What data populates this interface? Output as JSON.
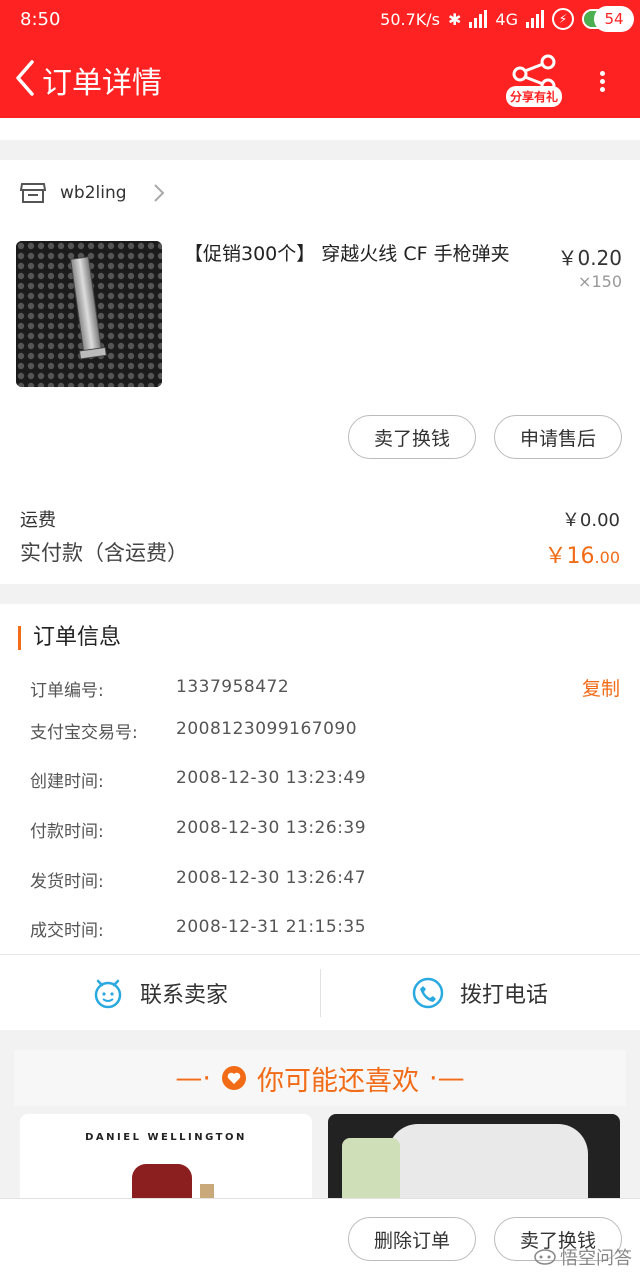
{
  "status_bar": {
    "time": "8:50",
    "network_speed": "50.7K/s",
    "network_type": "4G",
    "battery": "47",
    "battery_level": 0.47
  },
  "nav": {
    "title": "订单详情",
    "share_badge": "分享有礼",
    "message_count": "54"
  },
  "shop": {
    "name": "wb2ling"
  },
  "product": {
    "title": "【促销300个】 穿越火线 CF 手枪弹夹",
    "price": "￥0.20",
    "quantity": "×150",
    "buttons": [
      "卖了换钱",
      "申请售后"
    ]
  },
  "payment": {
    "shipping_label": "运费",
    "shipping_value": "￥0.00",
    "paid_label": "实付款（含运费）",
    "paid_value_main": "￥16",
    "paid_value_cents": ".00"
  },
  "order_info": {
    "title": "订单信息",
    "copy_label": "复制",
    "rows": [
      {
        "label": "订单编号:",
        "value": "1337958472"
      },
      {
        "label": "支付宝交易号:",
        "value": "2008123099167090"
      },
      {
        "label": "创建时间:",
        "value": "2008-12-30 13:23:49"
      },
      {
        "label": "付款时间:",
        "value": "2008-12-30 13:26:39"
      },
      {
        "label": "发货时间:",
        "value": "2008-12-30 13:26:47"
      },
      {
        "label": "成交时间:",
        "value": "2008-12-31 21:15:35"
      }
    ]
  },
  "contact": {
    "seller": "联系卖家",
    "phone": "拨打电话"
  },
  "recommend": {
    "title": "你可能还喜欢",
    "item1_brand": "DANIEL WELLINGTON"
  },
  "bottom": {
    "delete": "删除订单",
    "resell": "卖了换钱",
    "watermark": "悟空问答"
  },
  "colors": {
    "brand": "#ff2222",
    "accent": "#f26b16",
    "contact_icon": "#2aa9e0"
  }
}
